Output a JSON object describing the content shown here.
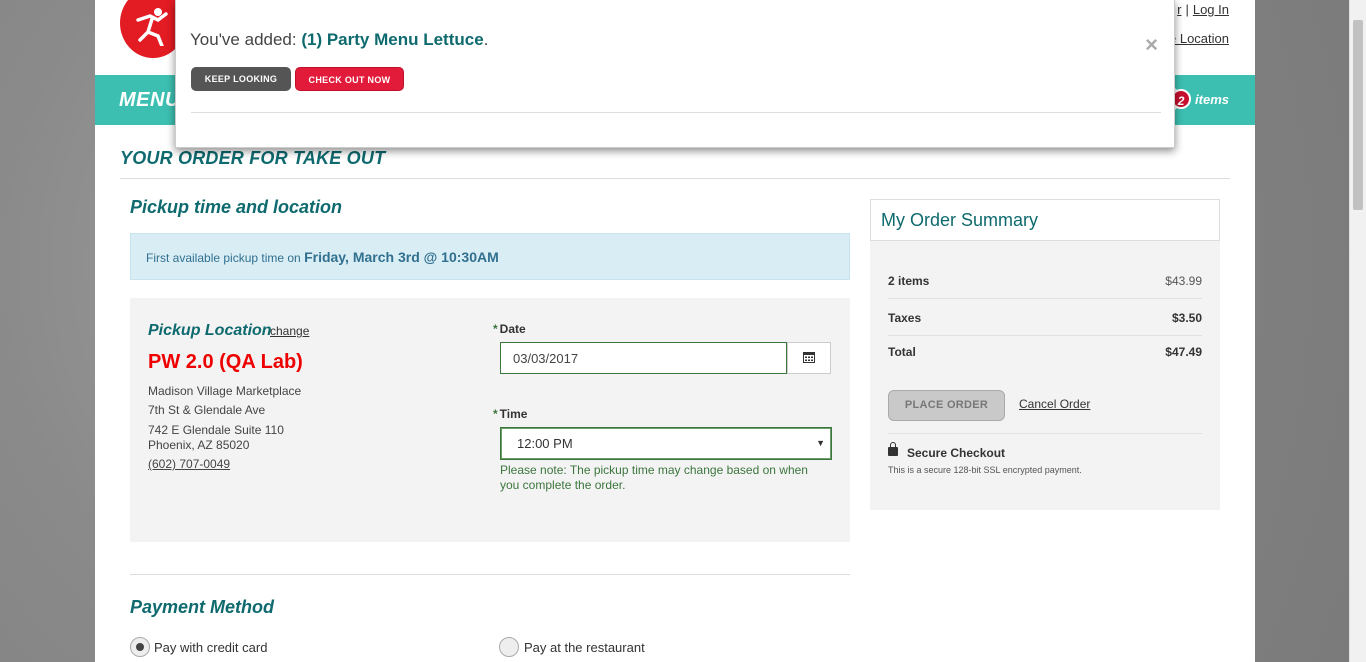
{
  "header": {
    "login_prefix": "r",
    "login_label": "Log In",
    "location_label": "e Location",
    "nav_menu_label": "MENU",
    "cart_count": "2",
    "cart_items_label": "items"
  },
  "page": {
    "heading": "YOUR ORDER FOR TAKE OUT"
  },
  "pickup": {
    "section_title": "Pickup time and location",
    "banner_prefix": "First available pickup time on",
    "banner_value": "Friday, March 3rd @ 10:30AM",
    "location_label": "Pickup Location",
    "change_label": "change",
    "store_name": "PW 2.0 (QA Lab)",
    "address_line1": "Madison Village Marketplace",
    "address_line2": "7th St & Glendale Ave",
    "address_line3": "742 E Glendale Suite 110",
    "address_line4": "Phoenix, AZ 85020",
    "phone": "(602) 707-0049",
    "date_label": "Date",
    "date_value": "03/03/2017",
    "time_label": "Time",
    "time_value": "12:00 PM",
    "required_mark": "*",
    "note": "Please note: The pickup time may change based on when you complete the order."
  },
  "payment": {
    "section_title": "Payment Method",
    "option_credit": "Pay with credit card",
    "option_restaurant": "Pay at the restaurant"
  },
  "summary": {
    "title": "My Order Summary",
    "items_label": "2 items",
    "items_value": "$43.99",
    "taxes_label": "Taxes",
    "taxes_value": "$3.50",
    "total_label": "Total",
    "total_value": "$47.49",
    "place_order_label": "PLACE ORDER",
    "cancel_label": "Cancel Order",
    "secure_title": "Secure Checkout",
    "secure_sub": "This is a secure 128-bit SSL encrypted payment."
  },
  "modal": {
    "added_prefix": "You've added:",
    "added_item": "(1) Party Menu Lettuce",
    "added_suffix": ".",
    "close_label": "×",
    "keep_looking_label": "KEEP LOOKING",
    "checkout_label": "CHECK OUT NOW"
  },
  "colors": {
    "brand_teal": "#3cbfb1",
    "heading_teal": "#0e6a6e",
    "brand_red": "#e31b23"
  }
}
